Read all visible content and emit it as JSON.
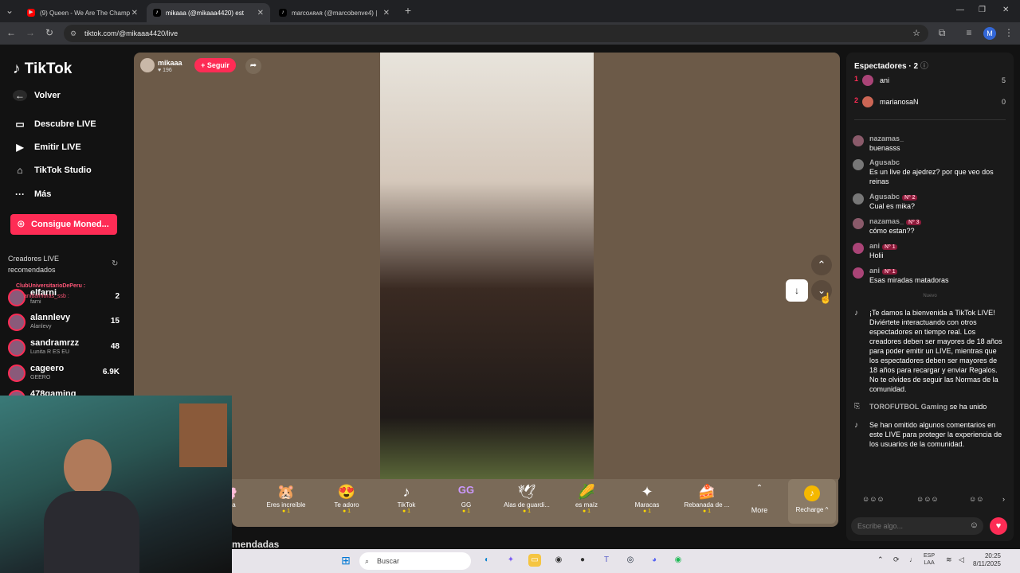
{
  "browser": {
    "tabs": [
      {
        "title": "(9) Queen - We Are The Champ",
        "active": false
      },
      {
        "title": "mikaaa (@mikaaa4420) est",
        "active": true
      },
      {
        "title": "marcoᴀʀᴀʀ (@marcobenve4) |",
        "active": false
      }
    ],
    "url": "tiktok.com/@mikaaa4420/live",
    "profile_initial": "M"
  },
  "sidebar": {
    "logo": "TikTok",
    "back_label": "Volver",
    "nav": [
      {
        "label": "Descubre LIVE",
        "icon": "live-tv-icon"
      },
      {
        "label": "Emitir LIVE",
        "icon": "camera-icon"
      },
      {
        "label": "TikTok Studio",
        "icon": "home-icon"
      },
      {
        "label": "Más",
        "icon": "more-dots-icon"
      }
    ],
    "coins_button": "Consigue Moned...",
    "creators_header": "Creadores LIVE recomendados",
    "creators": [
      {
        "name": "elfarni",
        "sub": "farni",
        "count": "2"
      },
      {
        "name": "alannlevy",
        "sub": "Alanlevy",
        "count": "15"
      },
      {
        "name": "sandramrzz",
        "sub": "Lunita R ES EU",
        "count": "48"
      },
      {
        "name": "cageero",
        "sub": "GEERO",
        "count": "6.9K"
      },
      {
        "name": "478gaming",
        "sub": "",
        "count": ""
      }
    ],
    "overlay_text_1": "ClubUniversitarioDePeru :",
    "overlay_text_2": "anibalmoras_ssb :"
  },
  "live": {
    "host_name": "mikaaa",
    "host_likes": "196",
    "follow_label": "+ Seguir",
    "new_label": "Nuevo"
  },
  "gifts": [
    {
      "name": "anca",
      "price": "",
      "icon": "🌸"
    },
    {
      "name": "Eres increíble",
      "price": "1",
      "icon": "🐹"
    },
    {
      "name": "Te adoro",
      "price": "1",
      "icon": "😍"
    },
    {
      "name": "TikTok",
      "price": "1",
      "icon": "♪"
    },
    {
      "name": "GG",
      "price": "1",
      "icon": "GG"
    },
    {
      "name": "Alas de guardi...",
      "price": "1",
      "icon": "🪽"
    },
    {
      "name": "es maíz",
      "price": "1",
      "icon": "🌽"
    },
    {
      "name": "Maracas",
      "price": "1",
      "icon": "🪇"
    },
    {
      "name": "Rebanada de ...",
      "price": "1",
      "icon": "🍰"
    }
  ],
  "gift_more_label": "More",
  "recharge_label": "Recharge ^",
  "below_text": "mendadas",
  "chat": {
    "viewers_header": "Espectadores · 2",
    "viewers": [
      {
        "rank": "1",
        "name": "ani",
        "count": "5"
      },
      {
        "rank": "2",
        "name": "marianosaN",
        "count": "0"
      }
    ],
    "messages": [
      {
        "user": "nazamas_",
        "badge": "",
        "text": "buenasss"
      },
      {
        "user": "Agusabc",
        "badge": "",
        "text": "Es un live de ajedrez? por que veo dos reinas"
      },
      {
        "user": "Agusabc",
        "badge": "Nº 2",
        "text": "Cual es mika?"
      },
      {
        "user": "nazamas_",
        "badge": "Nº 3",
        "text": "cómo estan??"
      },
      {
        "user": "ani",
        "badge": "Nº 1",
        "text": "Holii"
      },
      {
        "user": "ani",
        "badge": "Nº 1",
        "text": "Esas miradas matadoras"
      }
    ],
    "welcome": "¡Te damos la bienvenida a TikTok LIVE! Diviértete interactuando con otros espectadores en tiempo real. Los creadores deben ser mayores de 18 años para poder emitir un LIVE, mientras que los espectadores deben ser mayores de 18 años para recargar y enviar Regalos. No te olvides de seguir las Normas de la comunidad.",
    "joined_user": "TOROFUTBOL Gaming",
    "joined_text": "se ha unido",
    "omitted": "Se han omitido algunos comentarios en este LIVE para proteger la experiencia de los usuarios de la comunidad.",
    "input_placeholder": "Escribe algo..."
  },
  "taskbar": {
    "search": "Buscar",
    "lang": "ESP",
    "lang2": "LAA",
    "time": "20:25",
    "date": "8/11/2025"
  }
}
